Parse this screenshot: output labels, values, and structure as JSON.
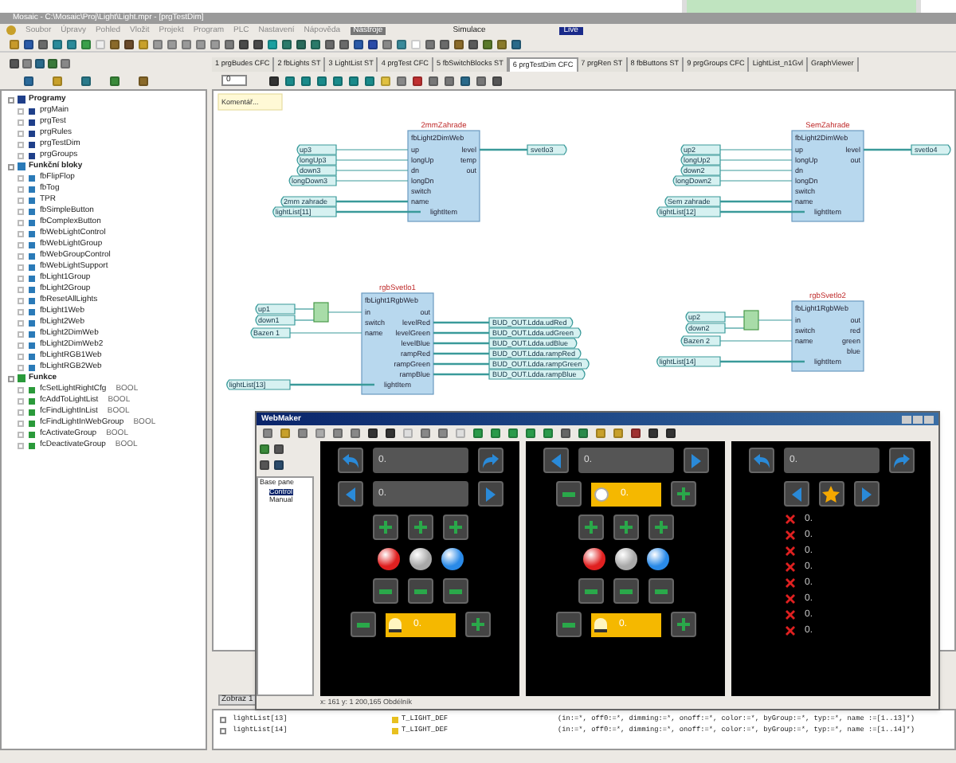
{
  "window": {
    "title": "Mosaic - C:\\Mosaic\\Proj\\Light\\Light.mpr - [prgTestDim]"
  },
  "menu": [
    {
      "label": "Soubor",
      "selected": false
    },
    {
      "label": "Úpravy",
      "selected": false
    },
    {
      "label": "Pohled",
      "selected": false
    },
    {
      "label": "Vložit",
      "selected": false
    },
    {
      "label": "Projekt",
      "selected": false
    },
    {
      "label": "Program",
      "selected": false
    },
    {
      "label": "PLC",
      "selected": false
    },
    {
      "label": "Nastavení",
      "selected": false
    },
    {
      "label": "Nápověda",
      "selected": false
    },
    {
      "label": "Nástroje",
      "selected": true
    }
  ],
  "mode_labels": [
    {
      "text": "Simulace",
      "kind": "plain"
    },
    {
      "text": "Live",
      "kind": "badge"
    }
  ],
  "tabs": [
    {
      "label": "1 prgBudes CFC",
      "selected": false
    },
    {
      "label": "2 fbLights ST",
      "selected": false
    },
    {
      "label": "3 LightList ST",
      "selected": false
    },
    {
      "label": "4 prgTest CFC",
      "selected": false
    },
    {
      "label": "5 fbSwitchBlocks ST",
      "selected": false
    },
    {
      "label": "6 prgTestDim CFC",
      "selected": true
    },
    {
      "label": "7 prgRen ST",
      "selected": false
    },
    {
      "label": "8 fbButtons ST",
      "selected": false
    },
    {
      "label": "9 prgGroups CFC",
      "selected": false
    },
    {
      "label": "LightList_n1Gvl",
      "selected": false
    },
    {
      "label": "GraphViewer",
      "selected": false
    }
  ],
  "zoom_field": {
    "value": "0"
  },
  "tree": [
    {
      "label": "Programy",
      "kind": "program",
      "expanded": true,
      "children": [
        {
          "label": "prgMain"
        },
        {
          "label": "prgTest"
        },
        {
          "label": "prgRules"
        },
        {
          "label": "prgTestDim"
        },
        {
          "label": "prgGroups"
        }
      ]
    },
    {
      "label": "Funkční bloky",
      "kind": "fblock",
      "expanded": true,
      "children": [
        {
          "label": "fbFlipFlop"
        },
        {
          "label": "fbTog"
        },
        {
          "label": "TPR"
        },
        {
          "label": "fbSimpleButton"
        },
        {
          "label": "fbComplexButton"
        },
        {
          "label": "fbWebLightControl"
        },
        {
          "label": "fbWebLightGroup"
        },
        {
          "label": "fbWebGroupControl"
        },
        {
          "label": "fbWebLightSupport"
        },
        {
          "label": "fbLight1Group"
        },
        {
          "label": "fbLight2Group"
        },
        {
          "label": "fbResetAllLights"
        },
        {
          "label": "fbLight1Web"
        },
        {
          "label": "fbLight2Web"
        },
        {
          "label": "fbLight2DimWeb"
        },
        {
          "label": "fbLight2DimWeb2"
        },
        {
          "label": "fbLightRGB1Web"
        },
        {
          "label": "fbLightRGB2Web"
        }
      ]
    },
    {
      "label": "Funkce",
      "kind": "function",
      "expanded": true,
      "children": [
        {
          "label": "fcSetLightRightCfg",
          "type": "BOOL"
        },
        {
          "label": "fcAddToLightList",
          "type": "BOOL"
        },
        {
          "label": "fcFindLightInList",
          "type": "BOOL"
        },
        {
          "label": "fcFindLightInWebGroup",
          "type": "BOOL"
        },
        {
          "label": "fcActivateGroup",
          "type": "BOOL"
        },
        {
          "label": "fcDeactivateGroup",
          "type": "BOOL"
        }
      ]
    }
  ],
  "diagram": {
    "comment": "Komentář...",
    "blocks": [
      {
        "title": "2mmZahrade",
        "type": "fbLight2DimWeb",
        "inputs": [
          {
            "pin": "up",
            "var": "up3"
          },
          {
            "pin": "longUp",
            "var": "longUp3"
          },
          {
            "pin": "dn",
            "var": "down3"
          },
          {
            "pin": "longDn",
            "var": "longDown3"
          },
          {
            "pin": "switch"
          },
          {
            "pin": "name",
            "var": "2mm zahrade"
          }
        ],
        "inout": {
          "pin": "lightItem",
          "var": "lightList[11]"
        },
        "outputs": [
          {
            "pin": "level",
            "var": "svetlo3"
          },
          {
            "pin": "temp"
          },
          {
            "pin": "out"
          }
        ]
      },
      {
        "title": "SemZahrade",
        "type": "fbLight2DimWeb",
        "inputs": [
          {
            "pin": "up",
            "var": "up2"
          },
          {
            "pin": "longUp",
            "var": "longUp2"
          },
          {
            "pin": "dn",
            "var": "down2"
          },
          {
            "pin": "longDn",
            "var": "longDown2"
          },
          {
            "pin": "switch"
          },
          {
            "pin": "name",
            "var": "Sem zahrade"
          }
        ],
        "inout": {
          "pin": "lightItem",
          "var": "lightList[12]"
        },
        "outputs": [
          {
            "pin": "level",
            "var": "svetlo4"
          },
          {
            "pin": "out"
          }
        ]
      },
      {
        "title": "rgbSvetlo1",
        "type": "fbLight1RgbWeb",
        "gate": [
          "up1",
          "down1"
        ],
        "inputs": [
          {
            "pin": "in"
          },
          {
            "pin": "switch"
          },
          {
            "pin": "name",
            "var": "Bazen 1"
          }
        ],
        "inout": {
          "pin": "lightItem",
          "var": "lightList[13]"
        },
        "outputs": [
          {
            "pin": "out"
          },
          {
            "pin": "levelRed",
            "var": "BUD_OUT.Ldda.udRed"
          },
          {
            "pin": "levelGreen",
            "var": "BUD_OUT.Ldda.udGreen"
          },
          {
            "pin": "levelBlue",
            "var": "BUD_OUT.Ldda.udBlue"
          },
          {
            "pin": "rampRed",
            "var": "BUD_OUT.Ldda.rampRed"
          },
          {
            "pin": "rampGreen",
            "var": "BUD_OUT.Ldda.rampGreen"
          },
          {
            "pin": "rampBlue",
            "var": "BUD_OUT.Ldda.rampBlue"
          }
        ]
      },
      {
        "title": "rgbSvetlo2",
        "type": "fbLight1RgbWeb",
        "gate": [
          "up2",
          "down2"
        ],
        "inputs": [
          {
            "pin": "in"
          },
          {
            "pin": "switch"
          },
          {
            "pin": "name",
            "var": "Bazen 2"
          }
        ],
        "inout": {
          "pin": "lightItem",
          "var": "lightList[14]"
        },
        "outputs": [
          {
            "pin": "out"
          },
          {
            "pin": "red"
          },
          {
            "pin": "green"
          },
          {
            "pin": "blue"
          }
        ]
      }
    ]
  },
  "side_tab": "Zobraz 1",
  "webmaker": {
    "title": "WebMaker",
    "tree": [
      {
        "label": "Base pane",
        "children": [
          {
            "label": "Control",
            "selected": true
          },
          {
            "label": "Manual",
            "selected": false
          }
        ]
      }
    ],
    "panels": [
      {
        "kind": "light",
        "header": "0.",
        "subheader": "0.",
        "footer": "0."
      },
      {
        "kind": "dimmer",
        "header": "0.",
        "dimmer": "0.",
        "footer": "0."
      },
      {
        "kind": "list",
        "header": "0.",
        "items": [
          "0.",
          "0.",
          "0.",
          "0.",
          "0.",
          "0.",
          "0.",
          "0."
        ]
      }
    ],
    "status": "x: 161 y: 1 200,165 Obdélník"
  },
  "declarations": [
    {
      "name": "lightList[13]",
      "type": "T_LIGHT_DEF",
      "init": "(in:=*, off0:=*, dimming:=*, onoff:=*, color:=*, byGroup:=*, typ:=*, name :=[1..13]*)"
    },
    {
      "name": "lightList[14]",
      "type": "T_LIGHT_DEF",
      "init": "(in:=*, off0:=*, dimming:=*, onoff:=*, color:=*, byGroup:=*, typ:=*, name :=[1..14]*)"
    }
  ]
}
